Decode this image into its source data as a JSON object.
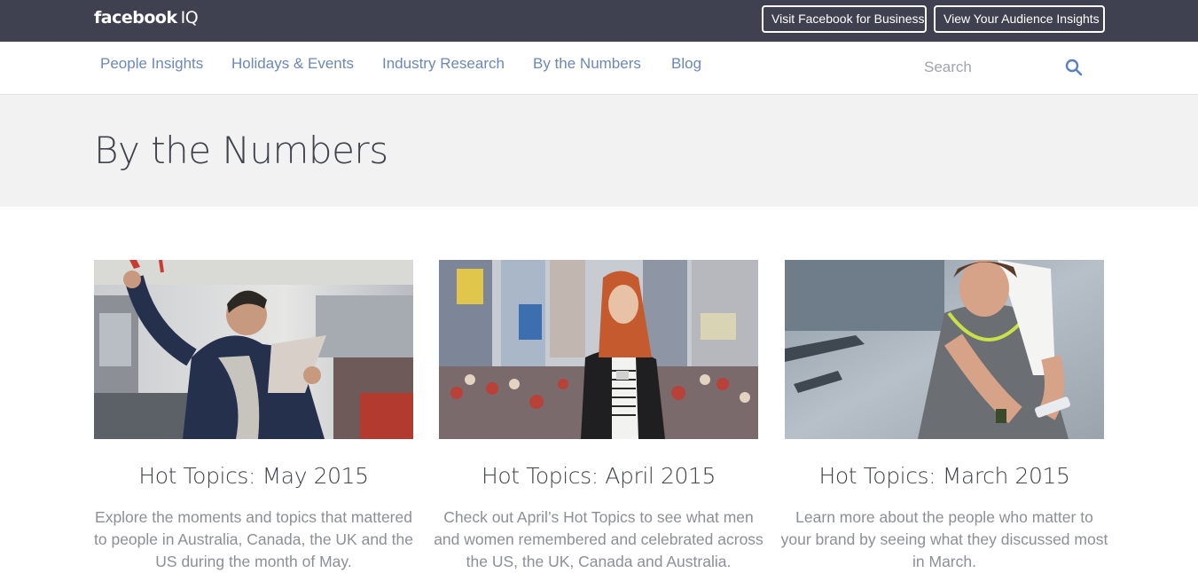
{
  "header": {
    "logo_brand": "facebook",
    "logo_suffix": "IQ",
    "buttons": {
      "business": "Visit Facebook for Business",
      "audience": "View Your Audience Insights"
    }
  },
  "nav": {
    "items": [
      {
        "label": "People Insights"
      },
      {
        "label": "Holidays & Events"
      },
      {
        "label": "Industry Research"
      },
      {
        "label": "By the Numbers"
      },
      {
        "label": "Blog"
      }
    ],
    "search": {
      "placeholder": "Search",
      "value": ""
    }
  },
  "page": {
    "title": "By the Numbers"
  },
  "cards": [
    {
      "title": "Hot Topics: May 2015",
      "description": "Explore the moments and topics that mattered to people in Australia, Canada, the UK and the US during the month of May."
    },
    {
      "title": "Hot Topics: April 2015",
      "description": "Check out April’s Hot Topics to see what men and women remembered and celebrated across the US, the UK, Canada and Australia."
    },
    {
      "title": "Hot Topics: March 2015",
      "description": "Learn more about the people who matter to your brand by seeing what they discussed most in March."
    }
  ],
  "colors": {
    "topbar": "#3f4150",
    "nav_link": "#6b88b6",
    "hero_bg": "#f2f2f2",
    "title_text": "#40434a",
    "body_text": "#8c8f95"
  },
  "icons": {
    "search": "search-icon"
  }
}
